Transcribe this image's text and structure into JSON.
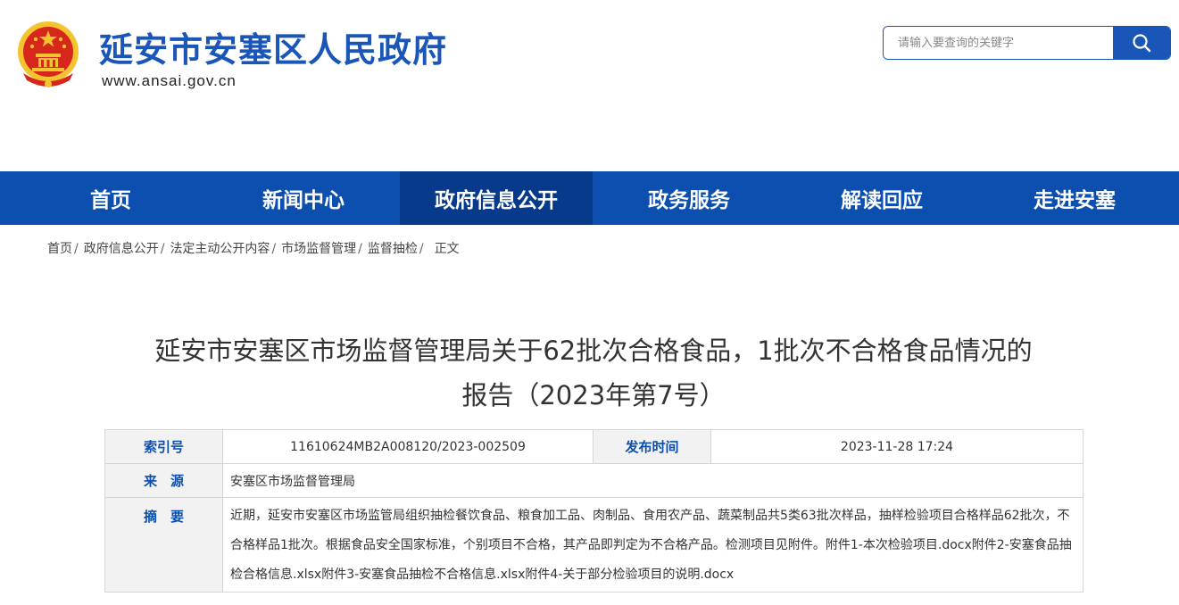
{
  "header": {
    "title": "延安市安塞区人民政府",
    "url": "www.ansai.gov.cn",
    "emblem_icon": "national-emblem-icon"
  },
  "search": {
    "placeholder": "请输入要查询的关键字",
    "icon": "search-icon"
  },
  "nav": {
    "items": [
      {
        "label": "首页"
      },
      {
        "label": "新闻中心"
      },
      {
        "label": "政府信息公开",
        "active": true
      },
      {
        "label": "政务服务"
      },
      {
        "label": "解读回应"
      },
      {
        "label": "走进安塞"
      }
    ]
  },
  "breadcrumb": {
    "items": [
      "首页",
      "政府信息公开",
      "法定主动公开内容",
      "市场监督管理",
      "监督抽检",
      "正文"
    ],
    "separator": "/"
  },
  "article": {
    "title_line1": "延安市安塞区市场监督管理局关于62批次合格食品，1批次不合格食品情况的",
    "title_line2": "报告（2023年第7号）"
  },
  "info": {
    "index_label": "索引号",
    "index_value": "11610624MB2A008120/2023-002509",
    "date_label": "发布时间",
    "date_value": "2023-11-28 17:24",
    "source_label": "来　源",
    "source_value": "安塞区市场监督管理局",
    "abstract_label": "摘　要",
    "abstract_value": "近期，延安市安塞区市场监管局组织抽检餐饮食品、粮食加工品、肉制品、食用农产品、蔬菜制品共5类63批次样品，抽样检验项目合格样品62批次，不合格样品1批次。根据食品安全国家标准，个别项目不合格，其产品即判定为不合格产品。检测项目见附件。附件1-本次检验项目.docx附件2-安塞食品抽检合格信息.xlsx附件3-安塞食品抽检不合格信息.xlsx附件4-关于部分检验项目的说明.docx"
  },
  "colors": {
    "brand_blue": "#1a56b8",
    "nav_bg": "#0d4fae",
    "nav_active": "#083a8c",
    "emblem_red": "#d7261c",
    "emblem_gold": "#f4c430"
  }
}
